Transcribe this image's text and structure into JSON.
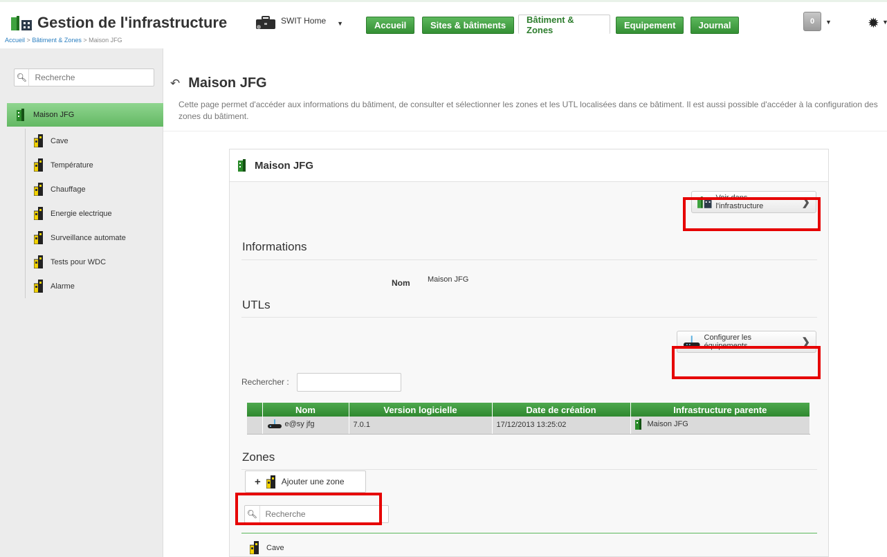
{
  "app": {
    "title": "Gestion de l'infrastructure"
  },
  "site_selector": {
    "label": "SWIT Home"
  },
  "nav": {
    "tabs": [
      {
        "label": "Accueil",
        "active": false
      },
      {
        "label": "Sites & bâtiments",
        "active": false
      },
      {
        "label": "Bâtiment & Zones",
        "active": true
      },
      {
        "label": "Equipement",
        "active": false
      },
      {
        "label": "Journal",
        "active": false
      }
    ]
  },
  "notifications": {
    "count": "0"
  },
  "breadcrumb": {
    "items": [
      "Accueil",
      "Bâtiment & Zones",
      "Maison JFG"
    ],
    "separator": ">"
  },
  "sidebar": {
    "search_placeholder": "Recherche",
    "root": {
      "label": "Maison JFG",
      "icon": "building-icon"
    },
    "items": [
      {
        "label": "Cave",
        "icon": "zone-icon"
      },
      {
        "label": "Température",
        "icon": "zone-icon"
      },
      {
        "label": "Chauffage",
        "icon": "zone-icon"
      },
      {
        "label": "Energie electrique",
        "icon": "zone-icon"
      },
      {
        "label": "Surveillance automate",
        "icon": "zone-icon"
      },
      {
        "label": "Tests pour WDC",
        "icon": "zone-icon"
      },
      {
        "label": "Alarme",
        "icon": "zone-icon"
      }
    ]
  },
  "page": {
    "title": "Maison JFG",
    "description": "Cette page permet d'accéder aux informations du bâtiment, de consulter et sélectionner les zones et les UTL localisées dans ce bâtiment. Il est aussi possible d'accéder à la configuration des zones du bâtiment."
  },
  "panel": {
    "title": "Maison JFG",
    "view_infra_button": "Voir dans l'infrastructure",
    "informations": {
      "heading": "Informations",
      "fields": [
        {
          "label": "Nom",
          "value": "Maison JFG"
        }
      ]
    },
    "utls": {
      "heading": "UTLs",
      "configure_button": "Configurer les équipements",
      "search_label": "Rechercher :",
      "columns": [
        "Nom",
        "Version logicielle",
        "Date de création",
        "Infrastructure parente"
      ],
      "rows": [
        {
          "nom": "e@sy jfg",
          "version": "7.0.1",
          "date": "17/12/2013 13:25:02",
          "parent": "Maison JFG"
        }
      ]
    },
    "zones": {
      "heading": "Zones",
      "add_button": "Ajouter une zone",
      "search_placeholder": "Recherche",
      "items": [
        {
          "label": "Cave"
        }
      ]
    }
  },
  "colors": {
    "accent_green": "#3f9b3f",
    "highlight_red": "#e60000",
    "sidebar_bg": "#ececec"
  }
}
